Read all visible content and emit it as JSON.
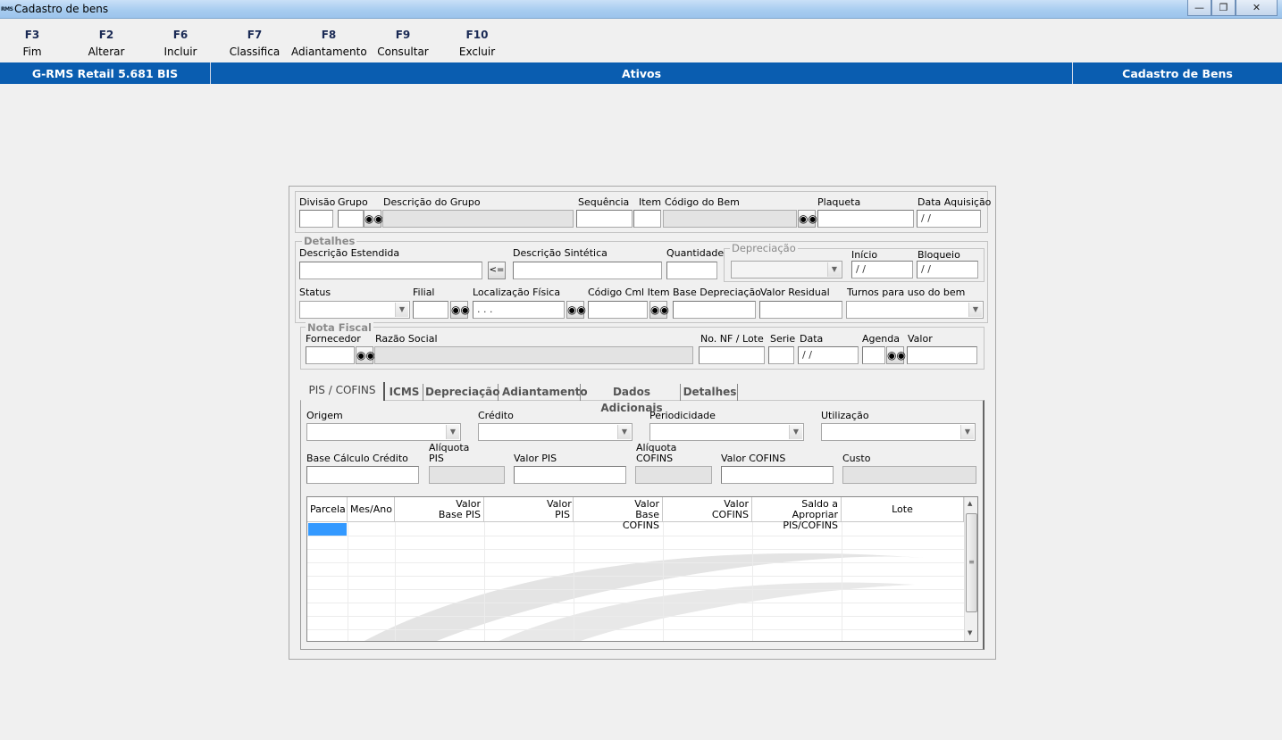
{
  "window": {
    "title": "Cadastro de bens",
    "icon_text": "RMS",
    "buttons": [
      "minimize-icon",
      "maximize-icon",
      "close-icon"
    ]
  },
  "toolbar": [
    {
      "key": "F3",
      "label": "Fim"
    },
    {
      "key": "F2",
      "label": "Alterar"
    },
    {
      "key": "F6",
      "label": "Incluir"
    },
    {
      "key": "F7",
      "label": "Classifica"
    },
    {
      "key": "F8",
      "label": "Adiantamento"
    },
    {
      "key": "F9",
      "label": "Consultar"
    },
    {
      "key": "F10",
      "label": "Excluir"
    }
  ],
  "bluebar": {
    "app": "G-RMS Retail 5.681 BIS",
    "module": "Ativos",
    "screen": "Cadastro de Bens"
  },
  "header": {
    "divisao": "Divisão",
    "grupo": "Grupo",
    "descricao_grupo": "Descrição do Grupo",
    "sequencia": "Sequência",
    "item": "Item",
    "codigo_bem": "Código do Bem",
    "plaqueta": "Plaqueta",
    "data_aquisicao": "Data Aquisição",
    "data_aquisicao_value": " / /"
  },
  "detalhes": {
    "title": "Detalhes",
    "descricao_estendida": "Descrição Estendida",
    "copy_button": "<=",
    "descricao_sintetica": "Descrição Sintética",
    "quantidade": "Quantidade",
    "depreciacao": "Depreciação",
    "inicio": "Início",
    "inicio_value": " / /",
    "bloqueio": "Bloqueio",
    "bloqueio_value": " / /",
    "status": "Status",
    "filial": "Filial",
    "localizacao": "Localização Física",
    "localizacao_value": " .  .  .",
    "codigo_cml": "Código Cml Item",
    "base_depreciacao": "Base Depreciação",
    "valor_residual": "Valor Residual",
    "turnos": "Turnos para uso do bem"
  },
  "nota_fiscal": {
    "title": "Nota Fiscal",
    "fornecedor": "Fornecedor",
    "razao_social": "Razão Social",
    "no_nf": "No. NF / Lote",
    "serie": "Serie",
    "data": "Data",
    "data_value": " / /",
    "agenda": "Agenda",
    "valor": "Valor"
  },
  "tabs": [
    "PIS / COFINS",
    "ICMS",
    "Depreciação",
    "Adiantamento",
    "Dados Adicionais",
    "Detalhes"
  ],
  "pis": {
    "origem": "Origem",
    "credito": "Crédito",
    "periodicidade": "Periodicidade",
    "utilizacao": "Utilização",
    "base_calculo": "Base Cálculo Crédito",
    "aliquota_pis": "Alíquota PIS",
    "valor_pis": "Valor PIS",
    "aliquota_cofins": "Alíquota COFINS",
    "valor_cofins": "Valor COFINS",
    "custo": "Custo"
  },
  "grid": {
    "columns": [
      "Parcela",
      "Mes/Ano",
      "Valor Base PIS",
      "Valor PIS",
      "Valor Base COFINS",
      "Valor COFINS",
      "Saldo a Apropriar PIS/COFINS",
      "Lote"
    ]
  }
}
